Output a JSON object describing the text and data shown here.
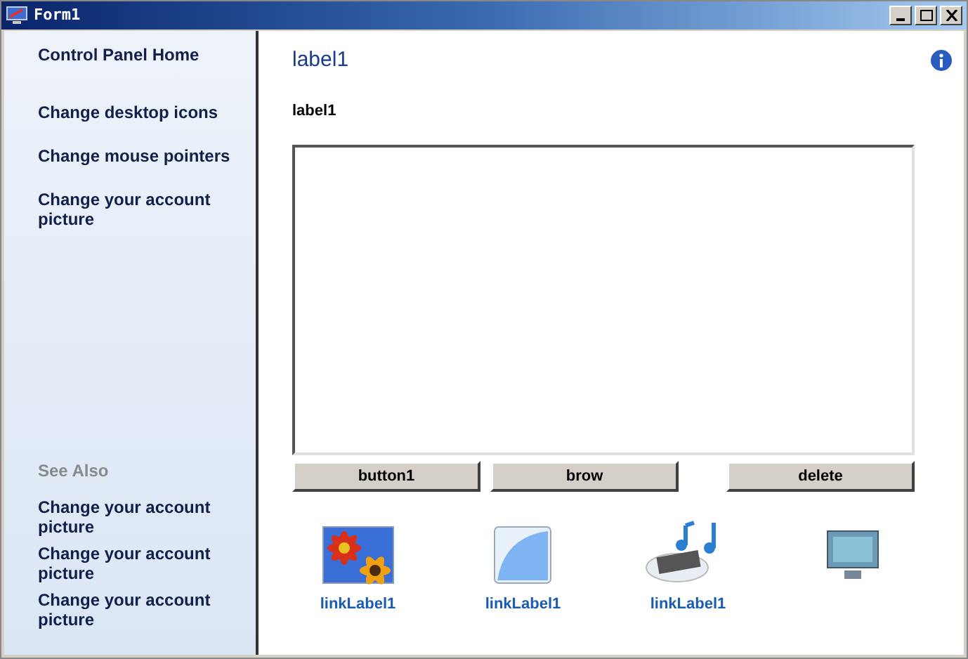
{
  "window": {
    "title": "Form1"
  },
  "sidebar": {
    "home": "Control Panel Home",
    "tasks": [
      "Change desktop icons",
      "Change mouse pointers",
      "Change your account picture"
    ],
    "see_also_title": "See Also",
    "see_also": [
      "Change your account picture",
      "Change your account picture",
      "Change your account picture"
    ]
  },
  "content": {
    "heading": "label1",
    "label": "label1",
    "buttons": [
      "button1",
      "brow",
      "delete"
    ],
    "links": [
      {
        "kind": "flower",
        "label": "linkLabel1"
      },
      {
        "kind": "blank",
        "label": "linkLabel1"
      },
      {
        "kind": "music",
        "label": "linkLabel1"
      },
      {
        "kind": "monitor"
      }
    ]
  }
}
